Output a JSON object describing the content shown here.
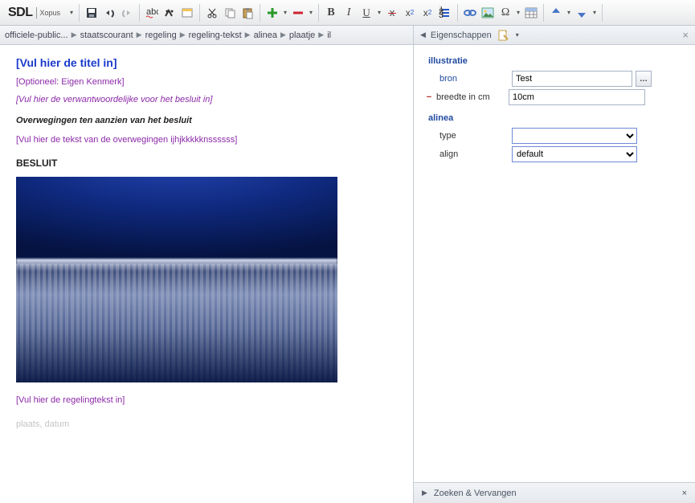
{
  "brand": {
    "name": "SDL",
    "product": "Xopus"
  },
  "toolbar": {
    "icons": [
      "save",
      "undo",
      "redo",
      "spellcheck",
      "find",
      "toggle",
      "cut",
      "copy",
      "paste",
      "add",
      "remove",
      "bold",
      "italic",
      "underline",
      "strike",
      "superscript",
      "subscript",
      "list",
      "link",
      "image",
      "symbol",
      "table",
      "move-up",
      "move-down"
    ]
  },
  "breadcrumb": [
    "officiele-public...",
    "staatscourant",
    "regeling",
    "regeling-tekst",
    "alinea",
    "plaatje",
    "il"
  ],
  "doc": {
    "title": "[Vul hier de titel in]",
    "optioneel": "[Optioneel: Eigen Kenmerk]",
    "verantw": "[Vul hier de verwantwoordelijke voor het besluit in]",
    "owv_head": "Overwegingen ten aanzien van het besluit",
    "owv_text": "[Vul hier de tekst van de overwegingen ijhjkkkkknssssss]",
    "besluit": "BESLUIT",
    "regeling": "[Vul hier de regelingtekst in]",
    "plaats": "plaats, datum"
  },
  "props": {
    "panel_title": "Eigenschappen",
    "sections": {
      "illustratie": "illustratie",
      "alinea": "alinea"
    },
    "bron_label": "bron",
    "bron_value": "Test",
    "breedte_label": "breedte in cm",
    "breedte_value": "10cm",
    "type_label": "type",
    "type_value": "",
    "align_label": "align",
    "align_value": "default"
  },
  "bottom": {
    "zoek": "Zoeken & Vervangen"
  }
}
